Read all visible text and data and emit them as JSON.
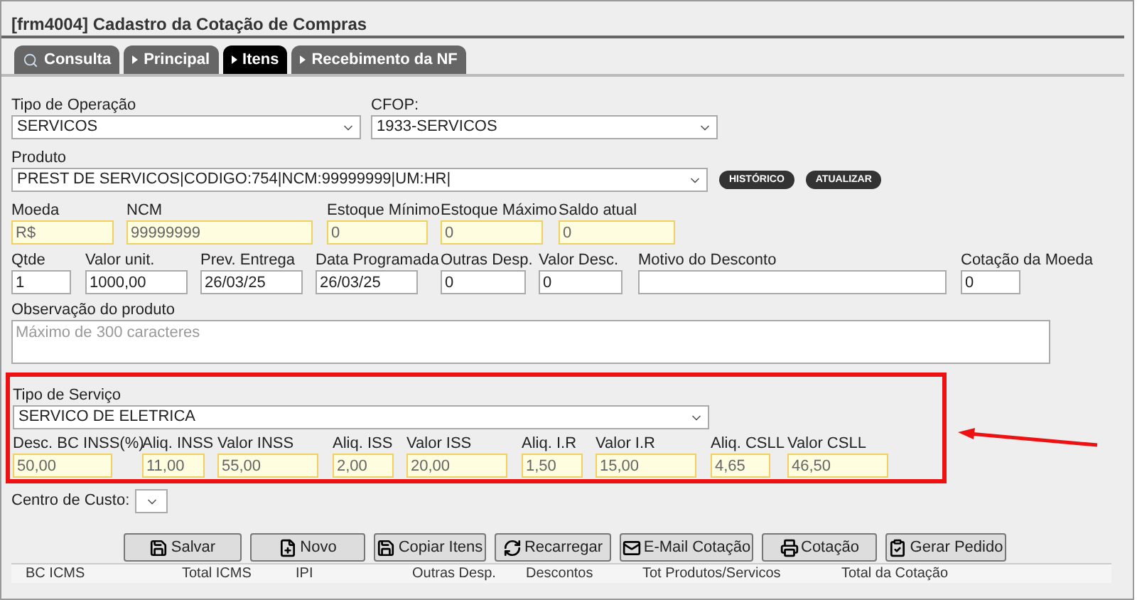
{
  "window": {
    "title": "[frm4004] Cadastro da Cotação de Compras"
  },
  "tabs": [
    {
      "label": "Consulta",
      "selected": false,
      "kind": "search"
    },
    {
      "label": "Principal",
      "selected": false,
      "kind": "arrow"
    },
    {
      "label": "Itens",
      "selected": true,
      "kind": "arrow"
    },
    {
      "label": "Recebimento da NF",
      "selected": false,
      "kind": "arrow"
    }
  ],
  "tipo_operacao": {
    "label": "Tipo de Operação",
    "value": "SERVICOS"
  },
  "cfop": {
    "label": "CFOP:",
    "value": "1933-SERVICOS"
  },
  "produto": {
    "label": "Produto",
    "value": "PREST DE SERVICOS|CODIGO:754|NCM:99999999|UM:HR|"
  },
  "produto_buttons": [
    "HISTÓRICO",
    "ATUALIZAR"
  ],
  "info_fields": [
    {
      "label": "Moeda",
      "value": "R$"
    },
    {
      "label": "NCM",
      "value": "99999999"
    },
    {
      "label": "Estoque Mínimo",
      "value": "0"
    },
    {
      "label": "Estoque Máximo",
      "value": "0"
    },
    {
      "label": "Saldo atual",
      "value": "0"
    }
  ],
  "item_fields": [
    {
      "label": "Qtde",
      "value": "1"
    },
    {
      "label": "Valor unit.",
      "value": "1000,00"
    },
    {
      "label": "Prev. Entrega",
      "value": "26/03/25"
    },
    {
      "label": "Data Programada",
      "value": "26/03/25"
    },
    {
      "label": "Outras Desp.",
      "value": "0"
    },
    {
      "label": "Valor Desc.",
      "value": "0"
    },
    {
      "label": "Motivo do Desconto"
    },
    {
      "label": "Cotação da Moeda",
      "value": "0"
    }
  ],
  "observacao": {
    "label": "Observação do produto",
    "placeholder": "Máximo de 300 caracteres"
  },
  "tipo_servico": {
    "label": "Tipo de Serviço",
    "value": "SERVICO DE ELETRICA"
  },
  "tax_fields": [
    {
      "label": "Desc. BC INSS(%)",
      "value": "50,00"
    },
    {
      "label": "Aliq. INSS",
      "value": "11,00"
    },
    {
      "label": "Valor INSS",
      "value": "55,00"
    },
    {
      "label": "Aliq. ISS",
      "value": "2,00"
    },
    {
      "label": "Valor ISS",
      "value": "20,00"
    },
    {
      "label": "Aliq. I.R",
      "value": "1,50"
    },
    {
      "label": "Valor I.R",
      "value": "15,00"
    },
    {
      "label": "Aliq. CSLL",
      "value": "4,65"
    },
    {
      "label": "Valor CSLL",
      "value": "46,50"
    }
  ],
  "centro_custo": {
    "label": "Centro de Custo:"
  },
  "buttons": [
    {
      "label": "Salvar",
      "kind": "save"
    },
    {
      "label": "Novo",
      "kind": "new"
    },
    {
      "label": "Copiar Itens",
      "kind": "save"
    },
    {
      "label": "Recarregar",
      "kind": "reload"
    },
    {
      "label": "E-Mail Cotação",
      "kind": "mail"
    },
    {
      "label": "Cotação",
      "kind": "print"
    },
    {
      "label": "Gerar Pedido",
      "kind": "order"
    }
  ],
  "totals_columns": [
    "BC ICMS",
    "Total ICMS",
    "IPI",
    "Outras Desp.",
    "Descontos",
    "Tot Produtos/Servicos",
    "Total da Cotação"
  ]
}
